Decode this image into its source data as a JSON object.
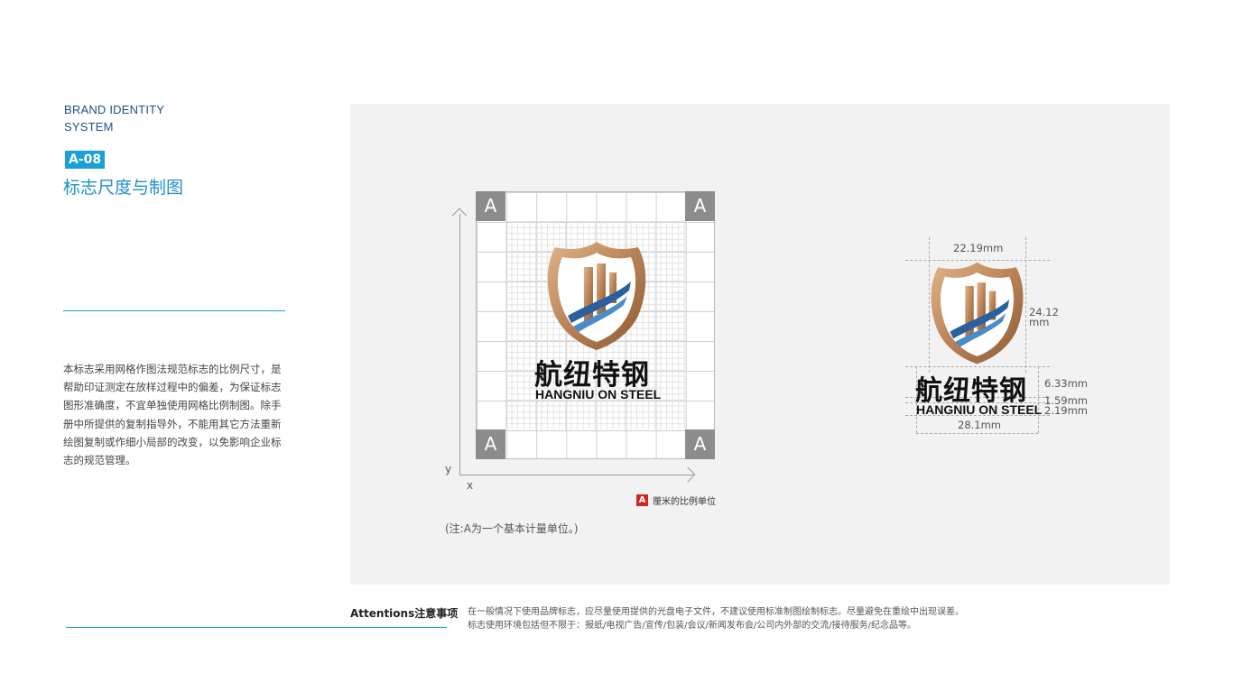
{
  "header": {
    "brand_line1": "BRAND IDENTITY",
    "brand_line2": "SYSTEM",
    "code": "A-08",
    "title": "标志尺度与制图"
  },
  "description": "本标志采用网格作图法规范标志的比例尺寸，是帮助印证测定在放样过程中的偏差，为保证标志图形准确度，不宜单独使用网格比例制图。除手册中所提供的复制指导外，不能用其它方法重新绘图复制或作细小局部的改变，以免影响企业标志的规范管理。",
  "grid_figure": {
    "corner_label": "A",
    "axis_y": "y",
    "axis_x": "x",
    "unit_key_symbol": "A",
    "unit_key_text": "厘米的比例单位",
    "note": "(注:A为一个基本计量单位。)"
  },
  "logo": {
    "name_cn": "航纽特钢",
    "name_en": "HANGNIU ON STEEL"
  },
  "dimensions": {
    "width_top": "22.19mm",
    "height_emblem_1": "24.12",
    "height_emblem_2": "mm",
    "cn_height": "6.33mm",
    "gap": "1.59mm",
    "en_height": "2.19mm",
    "width_bottom": "28.1mm"
  },
  "attentions": {
    "title": "Attentions注意事项",
    "line1": "在一般情况下使用品牌标志，应尽量使用提供的光盘电子文件，不建议使用标准制图绘制标志。尽量避免在重绘中出现误差。",
    "line2": "标志使用环境包括但不限于：报纸/电视广告/宣传/包装/会议/新闻发布会/公司内外部的交流/接待服务/纪念品等。"
  },
  "colors": {
    "accent": "#1aa0d8",
    "brand_blue": "#1d4f84",
    "emblem_bronze": "#b98255",
    "emblem_blue": "#2a5fa0",
    "unit_red": "#d32424",
    "corner_gray": "#8c8c8c"
  }
}
